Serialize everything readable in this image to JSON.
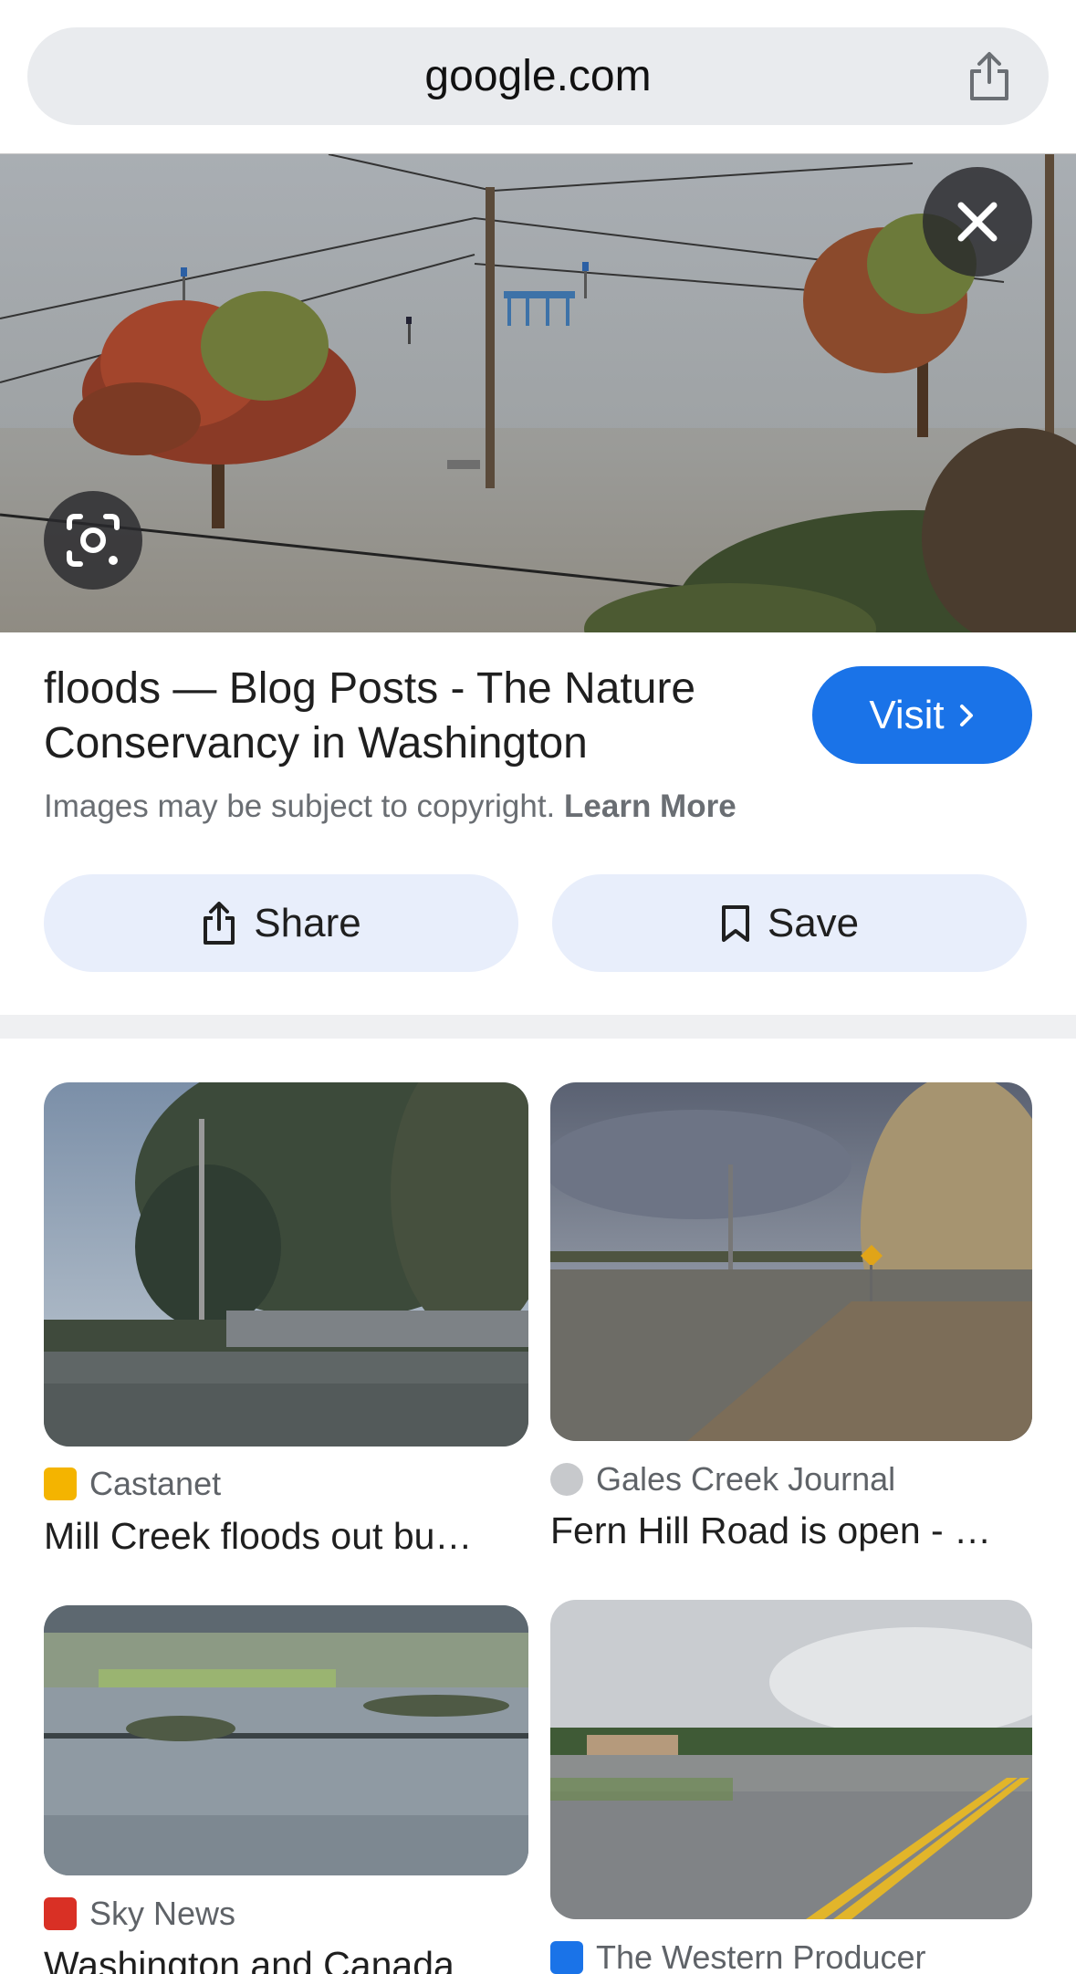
{
  "browser": {
    "url": "google.com",
    "share_icon": "share-icon"
  },
  "hero": {
    "close_icon": "close-icon",
    "lens_icon": "google-lens-icon"
  },
  "result": {
    "title": "floods — Blog Posts - The Nature Conservancy in Washington",
    "visit_label": "Visit",
    "copyright_text": "Images may be subject to copyright.",
    "learn_more": "Learn More",
    "share_label": "Share",
    "save_label": "Save"
  },
  "related": [
    {
      "source": "Castanet",
      "caption": "Mill Creek floods out bu…",
      "favicon_color": "#f4b400"
    },
    {
      "source": "Gales Creek Journal",
      "caption": "Fern Hill Road is open - …",
      "favicon_color": "#9aa0a6"
    },
    {
      "source": "Sky News",
      "caption": "Washington and Canada",
      "favicon_color": "#d93025"
    },
    {
      "source": "The Western Producer",
      "caption": "",
      "favicon_color": "#1a73e8"
    }
  ],
  "colors": {
    "accent": "#1a73e8",
    "button_bg": "#e8eefb",
    "urlbar_bg": "#e9ebee"
  }
}
